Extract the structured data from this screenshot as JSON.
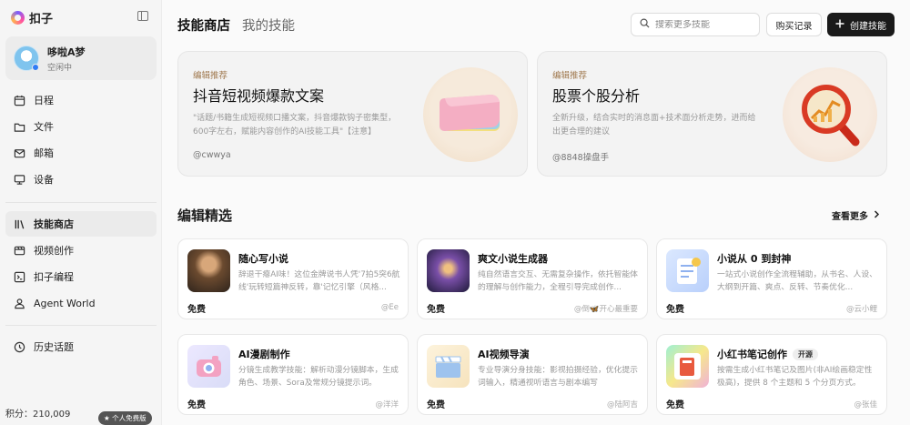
{
  "sidebar": {
    "brand": "扣子",
    "user": {
      "name": "哆啦A梦",
      "status": "空闲中"
    },
    "nav_top": [
      {
        "label": "日程",
        "icon": "calendar-icon"
      },
      {
        "label": "文件",
        "icon": "folder-icon"
      },
      {
        "label": "邮箱",
        "icon": "mail-icon"
      },
      {
        "label": "设备",
        "icon": "monitor-icon"
      }
    ],
    "nav_mid": [
      {
        "label": "技能商店",
        "icon": "library-icon",
        "active": true
      },
      {
        "label": "视频创作",
        "icon": "video-icon"
      },
      {
        "label": "扣子编程",
        "icon": "code-icon"
      },
      {
        "label": "Agent World",
        "icon": "agent-icon"
      }
    ],
    "history": {
      "label": "历史话题",
      "icon": "history-icon"
    },
    "points_label": "积分：210,009",
    "plan_badge": "★ 个人免费版"
  },
  "header": {
    "tab_active": "技能商店",
    "tab_inactive": "我的技能",
    "search_placeholder": "搜索更多技能",
    "buy_label": "购买记录",
    "create_label": "创建技能"
  },
  "featured": [
    {
      "tag": "编辑推荐",
      "title": "抖音短视频爆款文案",
      "desc": "\"话题/书籍生成短视频口播文案，抖音爆款钩子密集型，600字左右，赋能内容创作的AI技能工具\"【注意】",
      "author": "@cwwya",
      "image": "book-icon"
    },
    {
      "tag": "编辑推荐",
      "title": "股票个股分析",
      "desc": "全新升级，结合实时的消息面+技术面分析走势，进而给出更合理的建议",
      "author": "@8848操盘手",
      "image": "magnifier-chart-icon"
    }
  ],
  "section": {
    "title": "编辑精选",
    "see_more": "查看更多"
  },
  "cards": [
    {
      "title": "随心写小说",
      "desc": "辞退干瘪AI味！这位金牌说书人凭'7拍5突6航线'玩转短篇神反转，靠'记忆引擎（风格...",
      "price": "免费",
      "author": "@Ee",
      "badge": "",
      "image": "novel-portrait"
    },
    {
      "title": "爽文小说生成器",
      "desc": "纯自然语言交互、无需复杂操作，依托智能体的理解与创作能力，全程引导完成创作...",
      "price": "免费",
      "author": "@倒🦋开心最重要",
      "badge": "",
      "image": "fantasy-scene"
    },
    {
      "title": "小说从 0 到封神",
      "desc": "一站式小说创作全流程辅助，从书名、人设、大纲到开篇、爽点、反转、节奏优化...",
      "price": "免费",
      "author": "@云小鲤",
      "badge": "",
      "image": "document-icon"
    },
    {
      "title": "AI漫剧制作",
      "desc": "分镜生成教学技能：解析动漫分镜脚本，生成角色、场景、Sora及常规分镜提示词。",
      "price": "免费",
      "author": "@洋洋",
      "badge": "",
      "image": "camera-icon"
    },
    {
      "title": "AI视频导演",
      "desc": "专业导演分身技能：影视拍摄经验，优化提示词输入，精通视听语言与剧本编写",
      "price": "免费",
      "author": "@陆阿吉",
      "badge": "",
      "image": "clapper-icon"
    },
    {
      "title": "小红书笔记创作",
      "desc": "按需生成小红书笔记及图片(非AI绘画稳定性极高)，提供 8 个主题和 5 个分页方式。",
      "price": "免费",
      "author": "@张佳",
      "badge": "开源",
      "image": "notebook-icon"
    }
  ]
}
